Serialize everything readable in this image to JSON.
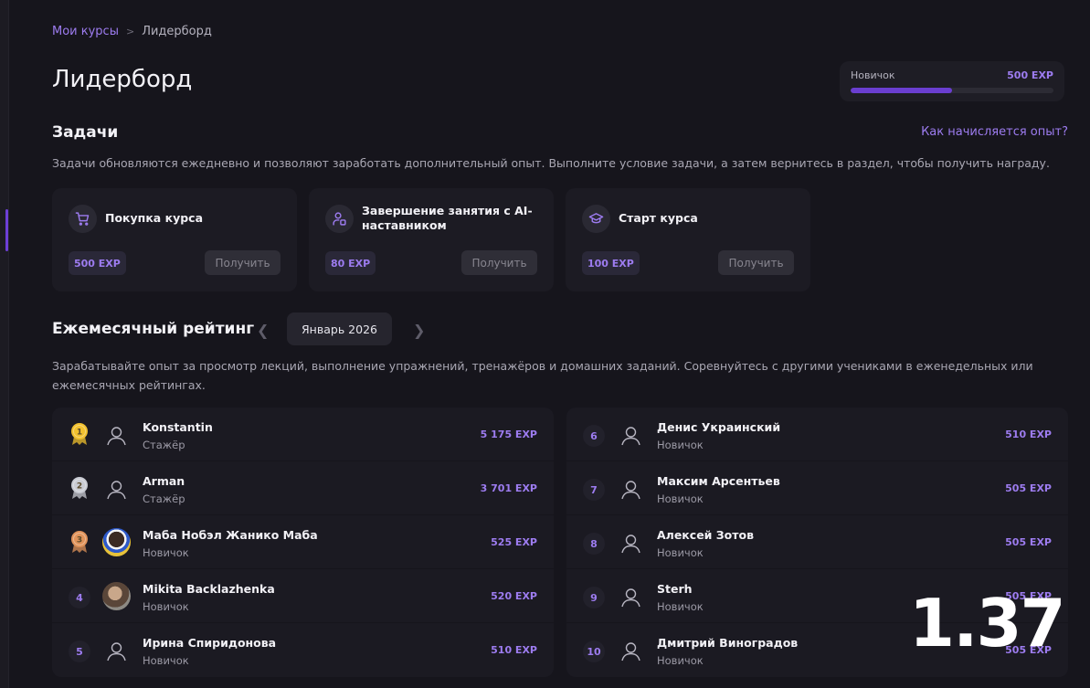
{
  "breadcrumb": {
    "link": "Мои курсы",
    "current": "Лидерборд"
  },
  "page_title": "Лидерборд",
  "level": {
    "name": "Новичок",
    "exp": "500 EXP",
    "progress": 0.5
  },
  "tasks_section": {
    "title": "Задачи",
    "help_link": "Как начисляется опыт?",
    "description": "Задачи обновляются ежедневно и позволяют заработать дополнительный опыт. Выполните условие задачи, а затем вернитесь в раздел, чтобы получить награду.",
    "cards": [
      {
        "icon": "cart-icon",
        "title": "Покупка курса",
        "exp": "500 EXP",
        "button": "Получить"
      },
      {
        "icon": "ai-mentor-icon",
        "title": "Завершение занятия с AI-наставником",
        "exp": "80 EXP",
        "button": "Получить"
      },
      {
        "icon": "graduation-cap-icon",
        "title": "Старт курса",
        "exp": "100 EXP",
        "button": "Получить"
      }
    ]
  },
  "rating_section": {
    "title": "Ежемесячный рейтинг",
    "month": "Январь 2026",
    "description": "Зарабатывайте опыт за просмотр лекций, выполнение упражнений, тренажёров и домашних заданий. Соревнуйтесь с другими учениками в еженедельных или ежемесячных рейтингах."
  },
  "leaderboard": {
    "left": [
      {
        "rank": "1",
        "name": "Konstantin",
        "level": "Стажёр",
        "exp": "5 175 EXP"
      },
      {
        "rank": "2",
        "name": "Arman",
        "level": "Стажёр",
        "exp": "3 701 EXP"
      },
      {
        "rank": "3",
        "name": "Маба Нобэл Жанико Маба",
        "level": "Новичок",
        "exp": "525 EXP"
      },
      {
        "rank": "4",
        "name": "Mikita Backlazhenka",
        "level": "Новичок",
        "exp": "520 EXP"
      },
      {
        "rank": "5",
        "name": "Ирина Спиридонова",
        "level": "Новичок",
        "exp": "510 EXP"
      }
    ],
    "right": [
      {
        "rank": "6",
        "name": "Денис Украинский",
        "level": "Новичок",
        "exp": "510 EXP"
      },
      {
        "rank": "7",
        "name": "Максим Арсентьев",
        "level": "Новичок",
        "exp": "505 EXP"
      },
      {
        "rank": "8",
        "name": "Алексей Зотов",
        "level": "Новичок",
        "exp": "505 EXP"
      },
      {
        "rank": "9",
        "name": "Sterh",
        "level": "Новичок",
        "exp": "505 EXP"
      },
      {
        "rank": "10",
        "name": "Дмитрий Виноградов",
        "level": "Новичок",
        "exp": "505 EXP"
      }
    ]
  },
  "overlay_number": "1.37",
  "colors": {
    "accent": "#9d7cf0",
    "gold": "#f2c12e",
    "silver": "#c9cbd3",
    "bronze": "#e0935a"
  }
}
